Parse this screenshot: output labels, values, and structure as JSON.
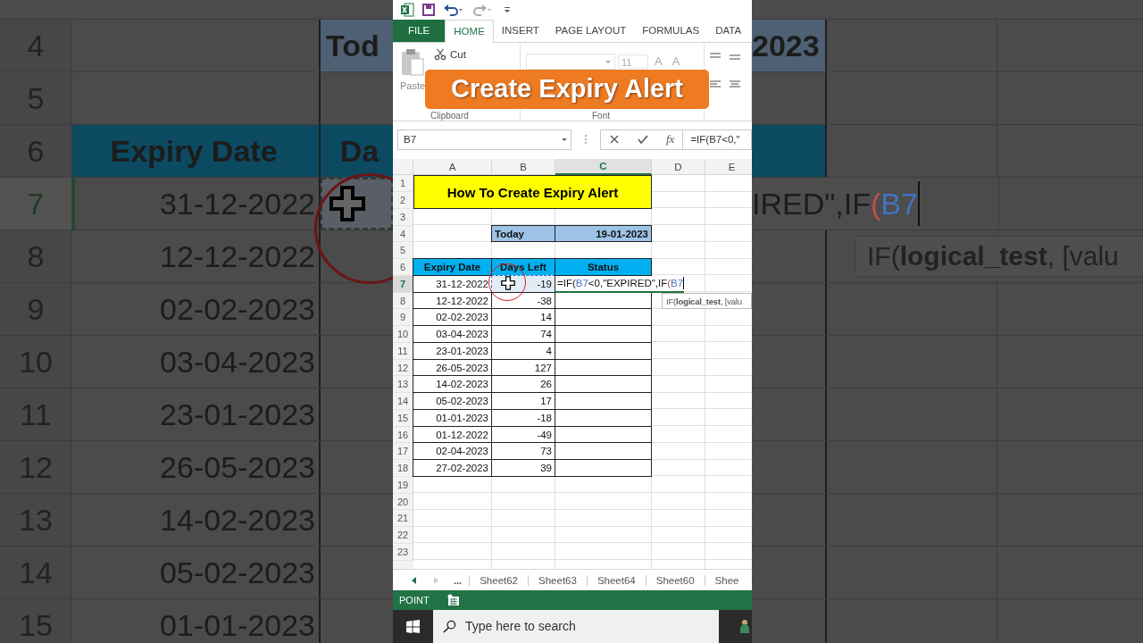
{
  "backdrop": {
    "left_rows": [
      {
        "row": "4",
        "kind": "today",
        "a": "",
        "b": "Tod"
      },
      {
        "row": "5",
        "kind": "blank",
        "a": "",
        "b": ""
      },
      {
        "row": "6",
        "kind": "header",
        "a": "Expiry Date",
        "b": "Da"
      },
      {
        "row": "7",
        "kind": "active",
        "a": "31-12-2022",
        "b": ""
      },
      {
        "row": "8",
        "kind": "data",
        "a": "12-12-2022",
        "b": ""
      },
      {
        "row": "9",
        "kind": "data",
        "a": "02-02-2023",
        "b": ""
      },
      {
        "row": "10",
        "kind": "data",
        "a": "03-04-2023",
        "b": ""
      },
      {
        "row": "11",
        "kind": "data",
        "a": "23-01-2023",
        "b": ""
      },
      {
        "row": "12",
        "kind": "data",
        "a": "26-05-2023",
        "b": ""
      },
      {
        "row": "13",
        "kind": "data",
        "a": "14-02-2023",
        "b": ""
      },
      {
        "row": "14",
        "kind": "data",
        "a": "05-02-2023",
        "b": ""
      },
      {
        "row": "15",
        "kind": "data",
        "a": "01-01-2023",
        "b": ""
      }
    ],
    "right_rows": [
      {
        "kind": "today",
        "c": "2023"
      },
      {
        "kind": "blank"
      },
      {
        "kind": "header"
      },
      {
        "kind": "active",
        "segments": [
          {
            "text": "IRED\",IF",
            "kind": "text"
          },
          {
            "text": "(",
            "kind": "paren"
          },
          {
            "text": "B7",
            "kind": "ref"
          }
        ]
      },
      {
        "kind": "tooltip",
        "tip": "IF(**logical_test**, [valu"
      },
      {
        "kind": "data"
      },
      {
        "kind": "data"
      },
      {
        "kind": "data"
      },
      {
        "kind": "data"
      },
      {
        "kind": "data"
      },
      {
        "kind": "data"
      },
      {
        "kind": "data"
      }
    ]
  },
  "ribbon_tabs": [
    {
      "label": "FILE",
      "kind": "file",
      "selected": false
    },
    {
      "label": "HOME",
      "kind": "tab",
      "selected": true
    },
    {
      "label": "INSERT",
      "kind": "tab",
      "selected": false
    },
    {
      "label": "PAGE LAYOUT",
      "kind": "tab",
      "selected": false
    },
    {
      "label": "FORMULAS",
      "kind": "tab",
      "selected": false
    },
    {
      "label": "DATA",
      "kind": "tab",
      "selected": false
    }
  ],
  "clipboard": {
    "cut": "Cut",
    "paste": "Paste",
    "group": "Clipboard"
  },
  "font": {
    "size": "11",
    "grow": "A",
    "shrink": "A",
    "group": "Font"
  },
  "banner": "Create Expiry Alert",
  "formula_bar": {
    "name_box": "B7",
    "function_label": "fx",
    "formula": "=IF(B7<0,\""
  },
  "sheet": {
    "columns": [
      {
        "label": "A",
        "selected": false
      },
      {
        "label": "B",
        "selected": false
      },
      {
        "label": "C",
        "selected": true
      },
      {
        "label": "D",
        "selected": false
      },
      {
        "label": "E",
        "selected": false
      }
    ],
    "row_numbers": [
      {
        "label": "1",
        "selected": false
      },
      {
        "label": "2",
        "selected": false
      },
      {
        "label": "3",
        "selected": false
      },
      {
        "label": "4",
        "selected": false
      },
      {
        "label": "5",
        "selected": false
      },
      {
        "label": "6",
        "selected": false
      },
      {
        "label": "7",
        "selected": true
      },
      {
        "label": "8",
        "selected": false
      },
      {
        "label": "9",
        "selected": false
      },
      {
        "label": "10",
        "selected": false
      },
      {
        "label": "11",
        "selected": false
      },
      {
        "label": "12",
        "selected": false
      },
      {
        "label": "13",
        "selected": false
      },
      {
        "label": "14",
        "selected": false
      },
      {
        "label": "15",
        "selected": false
      },
      {
        "label": "16",
        "selected": false
      },
      {
        "label": "17",
        "selected": false
      },
      {
        "label": "18",
        "selected": false
      },
      {
        "label": "19",
        "selected": false
      },
      {
        "label": "20",
        "selected": false
      },
      {
        "label": "21",
        "selected": false
      },
      {
        "label": "22",
        "selected": false
      },
      {
        "label": "23",
        "selected": false
      }
    ],
    "title": "How To Create Expiry Alert",
    "today_label": "Today",
    "today_value": "19-01-2023",
    "headers": [
      "Expiry Date",
      "Days Left",
      "Status"
    ],
    "records": [
      {
        "date": "31-12-2022",
        "days": "-19",
        "marked": true
      },
      {
        "date": "12-12-2022",
        "days": "-38",
        "marked": false
      },
      {
        "date": "02-02-2023",
        "days": "14",
        "marked": false
      },
      {
        "date": "03-04-2023",
        "days": "74",
        "marked": false
      },
      {
        "date": "23-01-2023",
        "days": "4",
        "marked": false
      },
      {
        "date": "26-05-2023",
        "days": "127",
        "marked": false
      },
      {
        "date": "14-02-2023",
        "days": "26",
        "marked": false
      },
      {
        "date": "05-02-2023",
        "days": "17",
        "marked": false
      },
      {
        "date": "01-01-2023",
        "days": "-18",
        "marked": false
      },
      {
        "date": "01-12-2022",
        "days": "-49",
        "marked": false
      },
      {
        "date": "02-04-2023",
        "days": "73",
        "marked": false
      },
      {
        "date": "27-02-2023",
        "days": "39",
        "marked": false
      }
    ],
    "editing": [
      {
        "text": "=IF(",
        "kind": "text"
      },
      {
        "text": "B7",
        "kind": "ref"
      },
      {
        "text": "<0,\"EXPIRED\",IF",
        "kind": "text"
      },
      {
        "text": "(",
        "kind": "paren"
      },
      {
        "text": "B7",
        "kind": "ref"
      }
    ],
    "tooltip": "IF(**logical_test**, [valu"
  },
  "sheet_tabs": {
    "more": "...",
    "tabs": [
      "Sheet62",
      "Sheet63",
      "Sheet64",
      "Sheet60",
      "Shee"
    ]
  },
  "status": "POINT",
  "taskbar": {
    "search_placeholder": "Type here to search"
  }
}
